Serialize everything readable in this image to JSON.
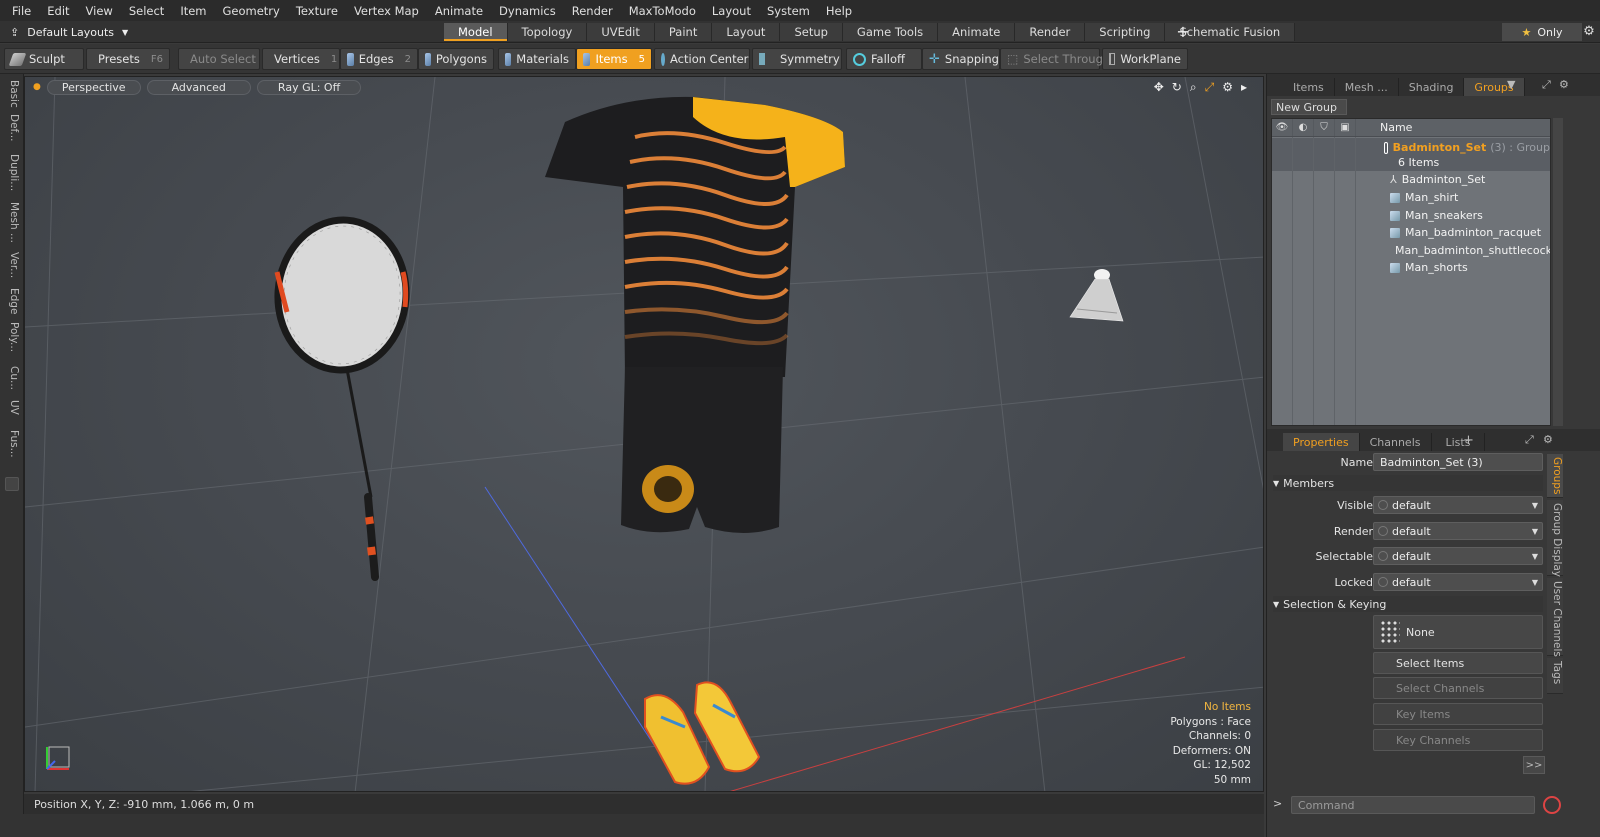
{
  "menu": [
    "File",
    "Edit",
    "View",
    "Select",
    "Item",
    "Geometry",
    "Texture",
    "Vertex Map",
    "Animate",
    "Dynamics",
    "Render",
    "MaxToModo",
    "Layout",
    "System",
    "Help"
  ],
  "layout": {
    "selector": "Default Layouts",
    "tabs": [
      "Model",
      "Topology",
      "UVEdit",
      "Paint",
      "Layout",
      "Setup",
      "Game Tools",
      "Animate",
      "Render",
      "Scripting",
      "Schematic Fusion"
    ],
    "active_tab": "Model",
    "only_label": "Only"
  },
  "toolbar": {
    "sculpt": "Sculpt",
    "presets": "Presets",
    "presets_key": "F6",
    "auto_select": "Auto Select",
    "vertices": "Vertices",
    "vertices_key": "1",
    "edges": "Edges",
    "edges_key": "2",
    "polygons": "Polygons",
    "materials": "Materials",
    "items": "Items",
    "items_key": "5",
    "action_center": "Action Center",
    "symmetry": "Symmetry",
    "falloff": "Falloff",
    "snapping": "Snapping",
    "select_through": "Select Through",
    "workplane": "WorkPlane"
  },
  "left_tabs": [
    "Basic",
    "Def...",
    "Dupli...",
    "Mesh ...",
    "Ver...",
    "Edge",
    "Poly...",
    "Cu...",
    "UV",
    "Fus..."
  ],
  "viewport": {
    "view": "Perspective",
    "advanced": "Advanced",
    "raygl": "Ray GL: Off",
    "stats": {
      "selection": "No Items",
      "polygons": "Polygons : Face",
      "channels": "Channels: 0",
      "deformers": "Deformers: ON",
      "gl": "GL: 12,502",
      "scale": "50 mm"
    }
  },
  "status": {
    "position": "Position X, Y, Z:  -910 mm, 1.066 m, 0 m"
  },
  "top_panel": {
    "tabs": [
      "Items",
      "Mesh ...",
      "Shading",
      "Groups"
    ],
    "active_tab": "Groups",
    "new_group": "New Group",
    "name_col": "Name",
    "group": {
      "name": "Badminton_Set",
      "suffix": "(3) : Group",
      "count": "6 Items",
      "children": [
        "Badminton_Set",
        "Man_shirt",
        "Man_sneakers",
        "Man_badminton_racquet",
        "Man_badminton_shuttlecock",
        "Man_shorts"
      ]
    }
  },
  "props": {
    "tabs": [
      "Properties",
      "Channels",
      "Lists"
    ],
    "active_tab": "Properties",
    "name_label": "Name",
    "name_value": "Badminton_Set (3)",
    "members": "Members",
    "visible_label": "Visible",
    "visible_value": "default",
    "render_label": "Render",
    "render_value": "default",
    "selectable_label": "Selectable",
    "selectable_value": "default",
    "locked_label": "Locked",
    "locked_value": "default",
    "sel_keying": "Selection & Keying",
    "none_btn": "None",
    "select_items": "Select Items",
    "select_channels": "Select Channels",
    "key_items": "Key Items",
    "key_channels": "Key Channels",
    "more": ">>",
    "side_tabs": [
      "Groups",
      "Group Display",
      "User Channels",
      "Tags"
    ]
  },
  "command": {
    "prompt": ">",
    "placeholder": "Command"
  },
  "colors": {
    "accent": "#f0a020",
    "shirt_black": "#1d1d1f",
    "shirt_yellow": "#f5b21a"
  }
}
